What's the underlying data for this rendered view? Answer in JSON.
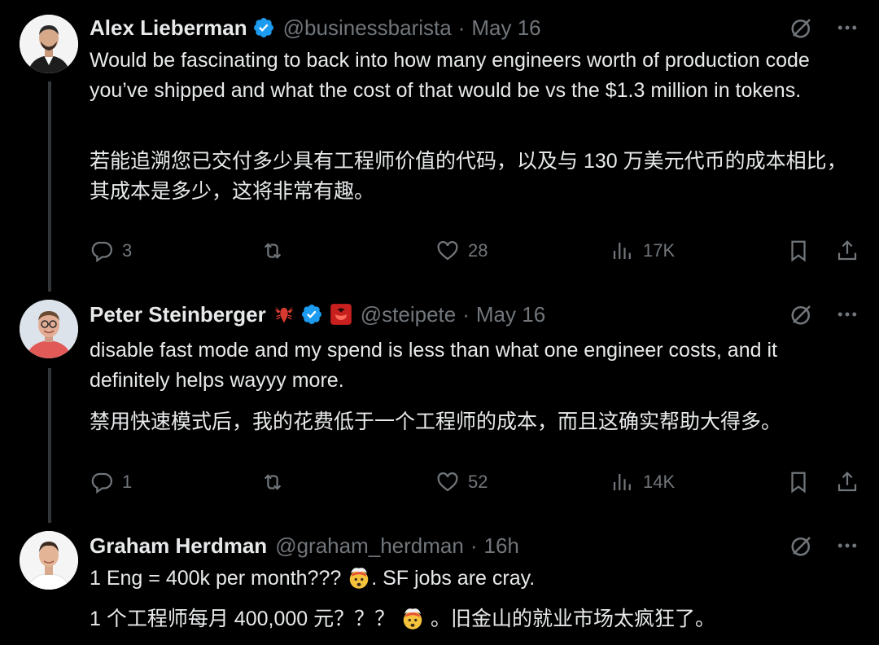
{
  "colors": {
    "background": "#000000",
    "text": "#e7e9ea",
    "muted": "#71767b",
    "verified_blue": "#1d9bf0",
    "thread_line": "#333639"
  },
  "tweets": [
    {
      "author": "Alex Lieberman",
      "verified": true,
      "handle": "@businessbarista",
      "dot": "·",
      "time": "May 16",
      "text_en": "Would be fascinating to back into how many engineers worth of production code you’ve shipped and what the cost of that would be vs the $1.3 million in tokens.",
      "text_zh": "若能追溯您已交付多少具有工程师价值的代码，以及与 130 万美元代币的成本相比，其成本是多少，这将非常有趣。",
      "replies": "3",
      "likes": "28",
      "views": "17K",
      "icons": [
        "grok-icon",
        "more-icon",
        "reply-icon",
        "retweet-icon",
        "like-icon",
        "views-icon",
        "bookmark-icon",
        "share-icon"
      ]
    },
    {
      "author": "Peter Steinberger",
      "author_emoji": "lobster-emoji",
      "verified": true,
      "badge": "red-cherry-badge",
      "handle": "@steipete",
      "dot": "·",
      "time": "May 16",
      "text_en": "disable fast mode and my spend is less than what one engineer costs, and it definitely helps wayyy more.",
      "text_zh": "禁用快速模式后，我的花费低于一个工程师的成本，而且这确实帮助大得多。",
      "replies": "1",
      "likes": "52",
      "views": "14K"
    },
    {
      "author": "Graham Herdman",
      "verified": false,
      "handle": "@graham_herdman",
      "dot": "·",
      "time": "16h",
      "text_en_a": "1 Eng = 400k per month??? ",
      "text_en_b": ". SF jobs are cray.",
      "text_zh_a": "1 个工程师每月 400,000 元？？？ ",
      "text_zh_b": " 。旧金山的就业市场太疯狂了。",
      "emoji": "exploding-head-emoji"
    }
  ]
}
